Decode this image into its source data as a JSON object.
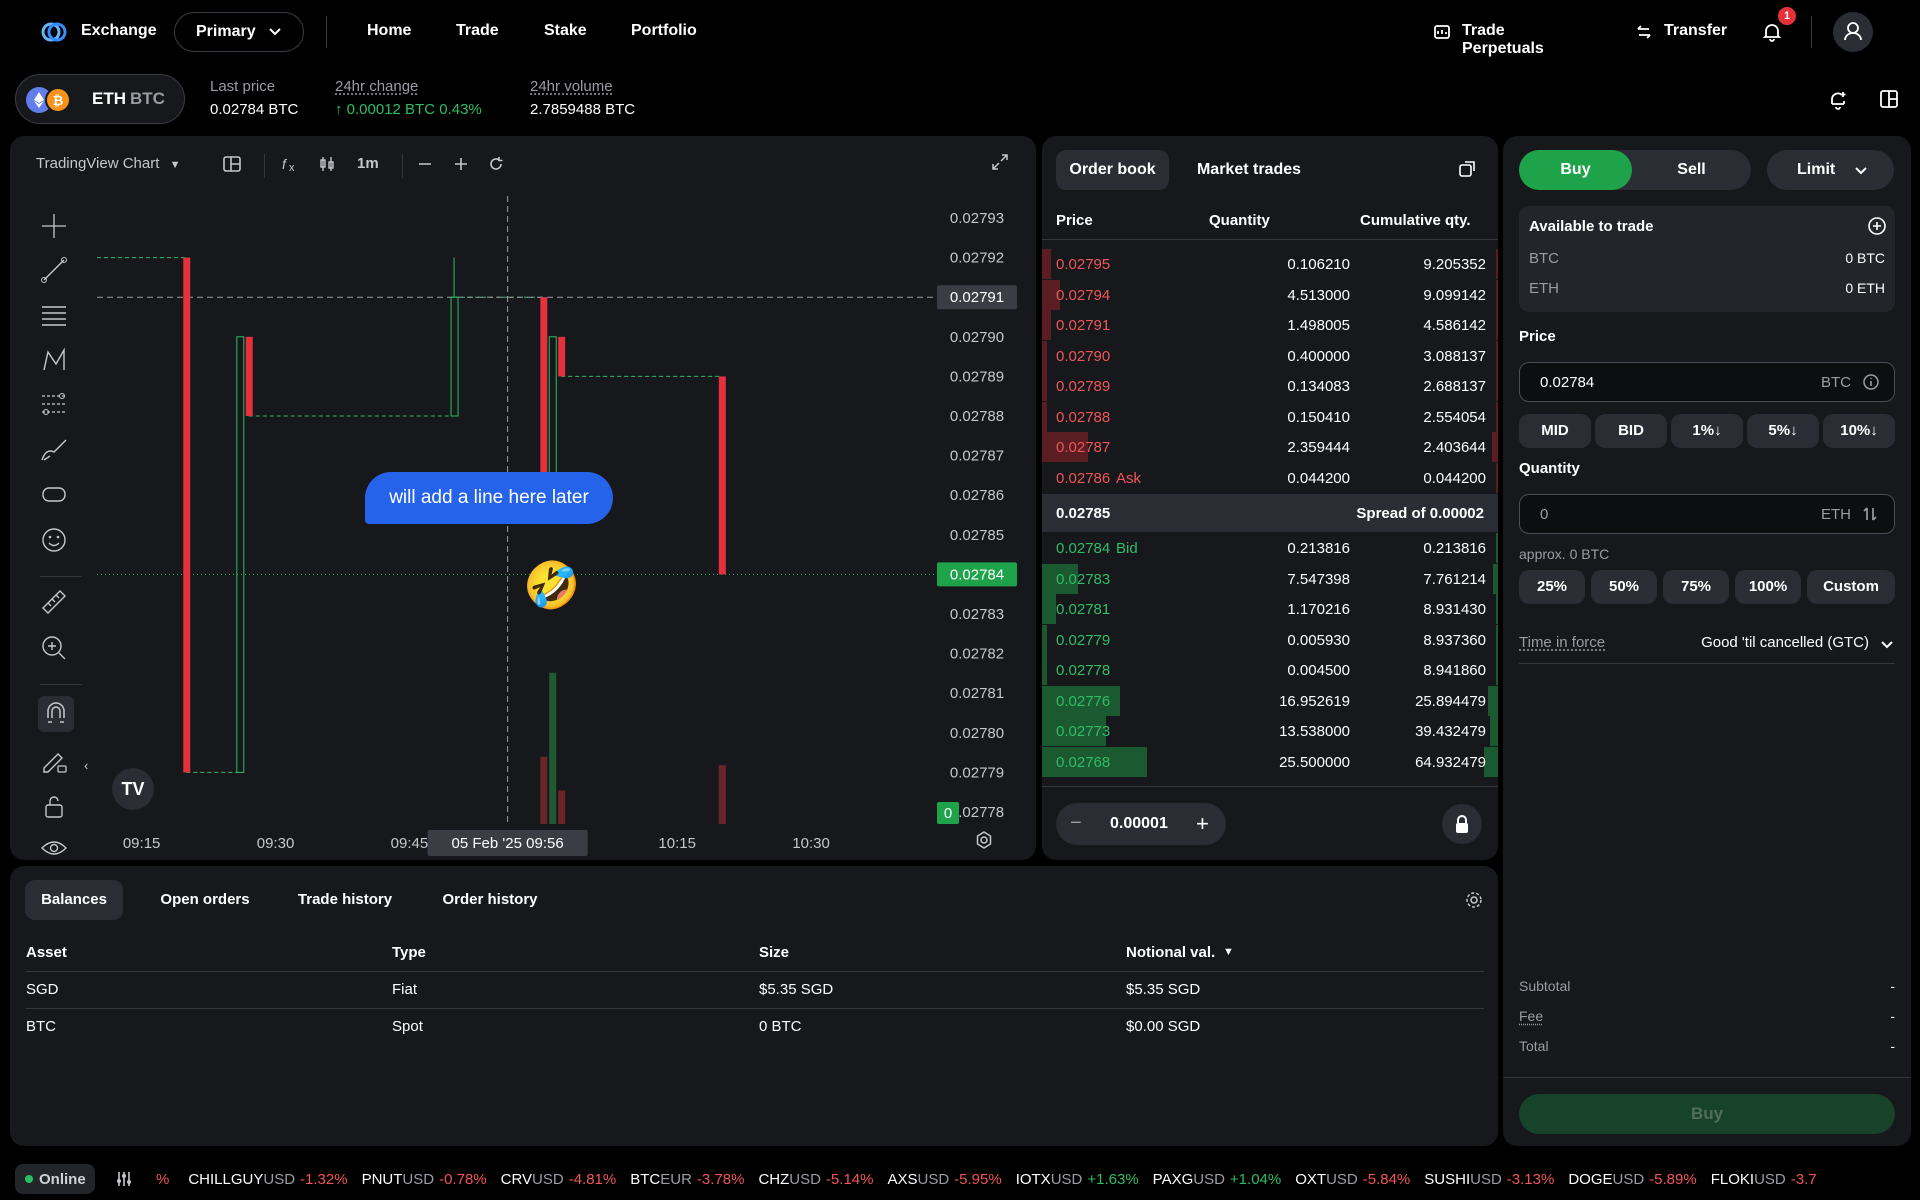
{
  "nav": {
    "logo_text": "Exchange",
    "account_selector": "Primary",
    "links": [
      "Home",
      "Trade",
      "Stake",
      "Portfolio"
    ],
    "trade_perpetuals": "Trade Perpetuals",
    "transfer": "Transfer",
    "notification_count": "1"
  },
  "market": {
    "pair_base": "ETH",
    "pair_quote": "BTC",
    "last_price_label": "Last price",
    "last_price": "0.02784 BTC",
    "change_label": "24hr change",
    "change_value": "↑ 0.00012 BTC 0.43%",
    "volume_label": "24hr volume",
    "volume_value": "2.7859488 BTC"
  },
  "chart": {
    "title": "TradingView Chart",
    "interval": "1m",
    "bubble_text": "will add a line here later",
    "emoji": "🤣",
    "crosshair_price": "0.02791",
    "current_price": "0.02784",
    "crosshair_time": "05 Feb '25  09:56",
    "volume_label": "0",
    "y_ticks": [
      "0.02793",
      "0.02792",
      "0.02791",
      "0.02790",
      "0.02789",
      "0.02788",
      "0.02787",
      "0.02786",
      "0.02785",
      "0.02784",
      "0.02783",
      "0.02782",
      "0.02781",
      "0.02780",
      "0.02779",
      "0.02778"
    ],
    "x_ticks": [
      "09:15",
      "09:30",
      "09:45",
      "10:15",
      "10:30"
    ]
  },
  "chart_data": {
    "type": "candlestick",
    "title": "",
    "y_range": [
      0.02778,
      0.02793
    ],
    "candles": [
      {
        "time": "09:20",
        "open": 0.02792,
        "close": 0.02779,
        "color": "red"
      },
      {
        "time": "09:26",
        "open": 0.02779,
        "close": 0.0279,
        "color": "green"
      },
      {
        "time": "09:27",
        "open": 0.0279,
        "close": 0.02788,
        "color": "red"
      },
      {
        "time": "09:50",
        "open": 0.02788,
        "close": 0.02791,
        "color": "green"
      },
      {
        "time": "10:00",
        "open": 0.02791,
        "close": 0.02786,
        "color": "red"
      },
      {
        "time": "10:01",
        "open": 0.02786,
        "close": 0.0279,
        "color": "green"
      },
      {
        "time": "10:02",
        "open": 0.0279,
        "close": 0.02789,
        "color": "red"
      },
      {
        "time": "10:20",
        "open": 0.02789,
        "close": 0.02784,
        "color": "red"
      }
    ],
    "volumes": [
      {
        "time": "10:00",
        "value": 0.4,
        "color": "red"
      },
      {
        "time": "10:01",
        "value": 0.9,
        "color": "green"
      },
      {
        "time": "10:02",
        "value": 0.2,
        "color": "red"
      },
      {
        "time": "10:20",
        "value": 0.35,
        "color": "red"
      }
    ]
  },
  "orderbook": {
    "tab_orderbook": "Order book",
    "tab_trades": "Market trades",
    "col_price": "Price",
    "col_qty": "Quantity",
    "col_cum": "Cumulative qty.",
    "asks": [
      {
        "price": "0.02795",
        "qty": "0.106210",
        "cum": "9.205352",
        "depth": 0.02
      },
      {
        "price": "0.02794",
        "qty": "4.513000",
        "cum": "9.099142",
        "depth": 0.04
      },
      {
        "price": "0.02791",
        "qty": "1.498005",
        "cum": "4.586142",
        "depth": 0.02
      },
      {
        "price": "0.02790",
        "qty": "0.400000",
        "cum": "3.088137",
        "depth": 0.01
      },
      {
        "price": "0.02789",
        "qty": "0.134083",
        "cum": "2.688137",
        "depth": 0.01
      },
      {
        "price": "0.02788",
        "qty": "0.150410",
        "cum": "2.554054",
        "depth": 0.01
      },
      {
        "price": "0.02787",
        "qty": "2.359444",
        "cum": "2.403644",
        "depth": 0.1
      },
      {
        "price": "0.02786",
        "qty": "0.044200",
        "cum": "0.044200",
        "depth": 0.0,
        "tag": "Ask"
      }
    ],
    "spread_price": "0.02785",
    "spread_text": "Spread of 0.00002",
    "bids": [
      {
        "price": "0.02784",
        "qty": "0.213816",
        "cum": "0.213816",
        "depth": 0.0,
        "tag": "Bid"
      },
      {
        "price": "0.02783",
        "qty": "7.547398",
        "cum": "7.761214",
        "depth": 0.08
      },
      {
        "price": "0.02781",
        "qty": "1.170216",
        "cum": "8.931430",
        "depth": 0.03
      },
      {
        "price": "0.02779",
        "qty": "0.005930",
        "cum": "8.937360",
        "depth": 0.01
      },
      {
        "price": "0.02778",
        "qty": "0.004500",
        "cum": "8.941860",
        "depth": 0.01
      },
      {
        "price": "0.02776",
        "qty": "16.952619",
        "cum": "25.894479",
        "depth": 0.17
      },
      {
        "price": "0.02773",
        "qty": "13.538000",
        "cum": "39.432479",
        "depth": 0.14
      },
      {
        "price": "0.02768",
        "qty": "25.500000",
        "cum": "64.932479",
        "depth": 0.23
      }
    ],
    "tick_size": "0.00001"
  },
  "order_form": {
    "buy": "Buy",
    "sell": "Sell",
    "order_type": "Limit",
    "available_title": "Available to trade",
    "avail_btc_label": "BTC",
    "avail_btc_value": "0 BTC",
    "avail_eth_label": "ETH",
    "avail_eth_value": "0 ETH",
    "price_label": "Price",
    "price_value": "0.02784",
    "price_unit": "BTC",
    "price_pills": [
      "MID",
      "BID",
      "1%↓",
      "5%↓",
      "10%↓"
    ],
    "qty_label": "Quantity",
    "qty_placeholder": "0",
    "qty_unit": "ETH",
    "approx": "approx. 0 BTC",
    "qty_pills": [
      "25%",
      "50%",
      "75%",
      "100%",
      "Custom"
    ],
    "tif_label": "Time in force",
    "tif_value": "Good 'til cancelled (GTC)",
    "subtotal_label": "Subtotal",
    "subtotal_value": "-",
    "fee_label": "Fee",
    "fee_value": "-",
    "total_label": "Total",
    "total_value": "-",
    "submit": "Buy"
  },
  "bottom": {
    "tabs": [
      "Balances",
      "Open orders",
      "Trade history",
      "Order history"
    ],
    "columns": [
      "Asset",
      "Type",
      "Size",
      "Notional val."
    ],
    "rows": [
      [
        "SGD",
        "Fiat",
        "$5.35 SGD",
        "$5.35 SGD"
      ],
      [
        "BTC",
        "Spot",
        "0 BTC",
        "$0.00 SGD"
      ]
    ]
  },
  "status": {
    "online": "Online",
    "tickers": [
      {
        "base": "%",
        "quote": "",
        "chg": "",
        "dir": "neg"
      },
      {
        "base": "CHILLGUY",
        "quote": "USD",
        "chg": "-1.32%",
        "dir": "neg"
      },
      {
        "base": "PNUT",
        "quote": "USD",
        "chg": "-0.78%",
        "dir": "neg"
      },
      {
        "base": "CRV",
        "quote": "USD",
        "chg": "-4.81%",
        "dir": "neg"
      },
      {
        "base": "BTC",
        "quote": "EUR",
        "chg": "-3.78%",
        "dir": "neg"
      },
      {
        "base": "CHZ",
        "quote": "USD",
        "chg": "-5.14%",
        "dir": "neg"
      },
      {
        "base": "AXS",
        "quote": "USD",
        "chg": "-5.95%",
        "dir": "neg"
      },
      {
        "base": "IOTX",
        "quote": "USD",
        "chg": "+1.63%",
        "dir": "pos"
      },
      {
        "base": "PAXG",
        "quote": "USD",
        "chg": "+1.04%",
        "dir": "pos"
      },
      {
        "base": "OXT",
        "quote": "USD",
        "chg": "-5.84%",
        "dir": "neg"
      },
      {
        "base": "SUSHI",
        "quote": "USD",
        "chg": "-3.13%",
        "dir": "neg"
      },
      {
        "base": "DOGE",
        "quote": "USD",
        "chg": "-5.89%",
        "dir": "neg"
      },
      {
        "base": "FLOKI",
        "quote": "USD",
        "chg": "-3.7",
        "dir": "neg"
      }
    ]
  }
}
